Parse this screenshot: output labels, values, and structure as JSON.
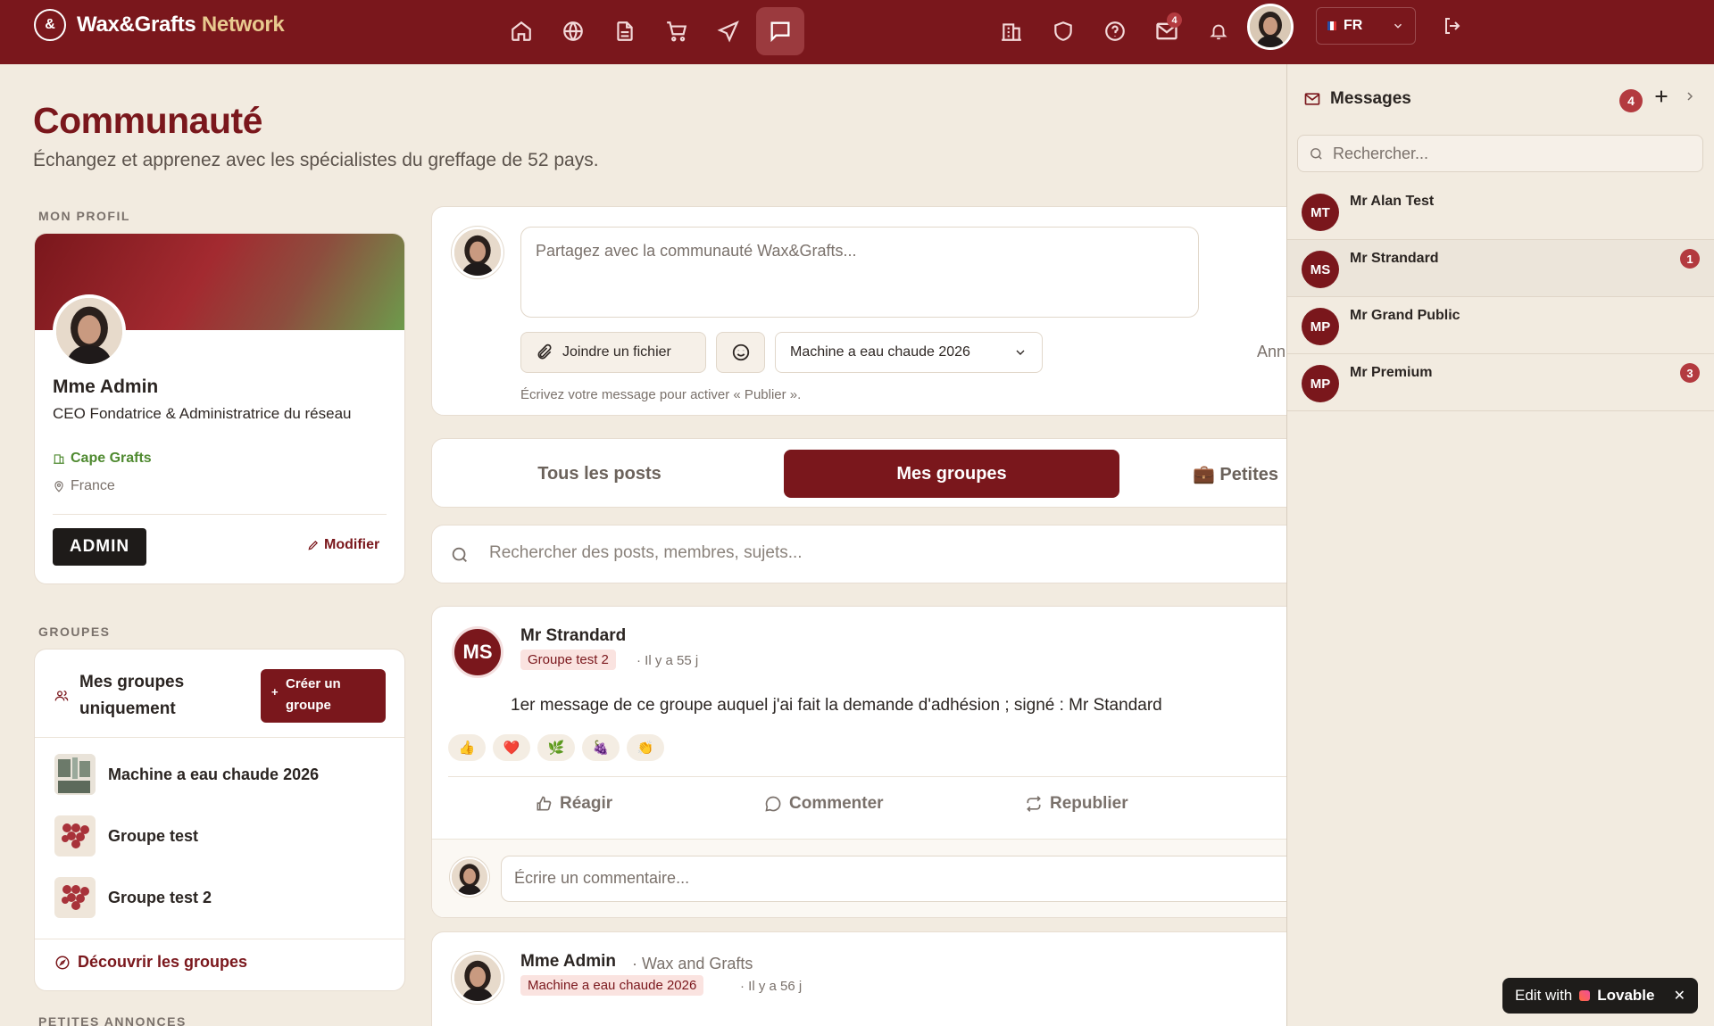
{
  "header": {
    "brand_main": "Wax&Grafts",
    "brand_accent": "Network",
    "nav_icons": [
      "home-icon",
      "globe-icon",
      "document-icon",
      "cart-icon",
      "plane-icon",
      "chat-icon"
    ],
    "active_nav": "chat-icon",
    "mail_count": "4",
    "language": "FR"
  },
  "page": {
    "title": "Communauté",
    "subtitle": "Échangez et apprenez avec les spécialistes du greffage de 52 pays."
  },
  "profile": {
    "section_label": "MON PROFIL",
    "name": "Mme Admin",
    "role": "CEO Fondatrice & Administratrice du réseau",
    "company": "Cape Grafts",
    "location": "France",
    "badge": "ADMIN",
    "edit_label": "Modifier"
  },
  "groups": {
    "section_label": "GROUPES",
    "filter_label": "Mes groupes uniquement",
    "create_label": "Créer un groupe",
    "items": [
      {
        "name": "Machine a eau chaude 2026"
      },
      {
        "name": "Groupe test"
      },
      {
        "name": "Groupe test 2"
      }
    ],
    "discover_label": "Découvrir les groupes"
  },
  "ads_section_label": "PETITES ANNONCES",
  "composer": {
    "placeholder": "Partagez avec la communauté Wax&Grafts...",
    "attach_label": "Joindre un fichier",
    "group_select": "Machine a eau chaude 2026",
    "anon_label": "Ann",
    "hint": "Écrivez votre message pour activer « Publier »."
  },
  "tabs": [
    {
      "label": "Tous les posts",
      "active": false
    },
    {
      "label": "Mes groupes",
      "active": true
    },
    {
      "label": "💼 Petites",
      "active": false
    }
  ],
  "feed_search_placeholder": "Rechercher des posts, membres, sujets...",
  "posts": [
    {
      "initials": "MS",
      "author": "Mr Strandard",
      "group": "Groupe test 2",
      "time": "· Il y a 55 j",
      "body": "1er message de ce groupe auquel j'ai fait la demande d'adhésion ; signé : Mr Standard",
      "reactions": [
        "👍",
        "❤️",
        "🌿",
        "🍇",
        "👏"
      ],
      "actions": {
        "react": "Réagir",
        "comment": "Commenter",
        "repost": "Republier"
      },
      "comment_placeholder": "Écrire un commentaire..."
    },
    {
      "author": "Mme Admin",
      "org": "· Wax and Grafts",
      "group": "Machine a eau chaude 2026",
      "time": "· Il y a 56 j"
    }
  ],
  "messages": {
    "title": "Messages",
    "unread": "4",
    "search_placeholder": "Rechercher...",
    "conversations": [
      {
        "initials": "MT",
        "name": "Mr Alan Test",
        "unread": ""
      },
      {
        "initials": "MS",
        "name": "Mr Strandard",
        "unread": "1"
      },
      {
        "initials": "MP",
        "name": "Mr Grand Public",
        "unread": ""
      },
      {
        "initials": "MP",
        "name": "Mr Premium",
        "unread": "3"
      }
    ]
  },
  "lovable": {
    "prefix": "Edit with",
    "brand": "Lovable"
  },
  "colors": {
    "brand": "#7a171c",
    "background": "#f2ebe0",
    "accent_green": "#4f8a30"
  }
}
